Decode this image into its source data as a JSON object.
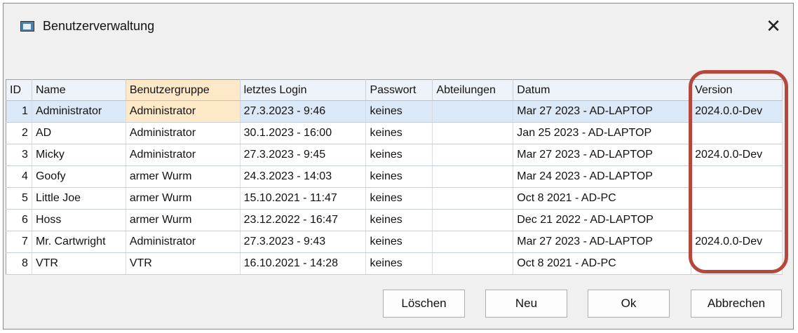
{
  "window": {
    "title": "Benutzerverwaltung",
    "icon": "window-app-icon",
    "close_label": "✕"
  },
  "table": {
    "columns": [
      "ID",
      "Name",
      "Benutzergruppe",
      "letztes Login",
      "Passwort",
      "Abteilungen",
      "Datum",
      "Version"
    ],
    "rows": [
      [
        "1",
        "Administrator",
        "Administrator",
        "27.3.2023 - 9:46",
        "keines",
        "",
        "Mar 27 2023 - AD-LAPTOP",
        "2024.0.0-Dev"
      ],
      [
        "2",
        "AD",
        "Administrator",
        "30.1.2023 - 16:00",
        "keines",
        "",
        "Jan 25 2023 - AD-LAPTOP",
        ""
      ],
      [
        "3",
        "Micky",
        "Administrator",
        "27.3.2023 - 9:45",
        "keines",
        "",
        "Mar 27 2023 - AD-LAPTOP",
        "2024.0.0-Dev"
      ],
      [
        "4",
        "Goofy",
        "armer Wurm",
        "24.3.2023 - 14:03",
        "keines",
        "",
        "Mar 24 2023 - AD-LAPTOP",
        ""
      ],
      [
        "5",
        "Little Joe",
        "armer Wurm",
        "15.10.2021 - 11:47",
        "keines",
        "",
        "Oct  8 2021 - AD-PC",
        ""
      ],
      [
        "6",
        "Hoss",
        "armer Wurm",
        "23.12.2022 - 16:47",
        "keines",
        "",
        "Dec 21 2022 - AD-LAPTOP",
        ""
      ],
      [
        "7",
        "Mr. Cartwright",
        "Administrator",
        "27.3.2023 - 9:43",
        "keines",
        "",
        "Mar 27 2023 - AD-LAPTOP",
        "2024.0.0-Dev"
      ],
      [
        "8",
        "VTR",
        "VTR",
        "16.10.2021 - 14:28",
        "keines",
        "",
        "Oct  8 2021 - AD-PC",
        ""
      ]
    ],
    "selected_row": 0,
    "sorted_column": 2
  },
  "buttons": {
    "delete": "Löschen",
    "new": "Neu",
    "ok": "Ok",
    "cancel": "Abbrechen"
  },
  "colors": {
    "selection": "#dbe8f7",
    "sort_highlight": "#fde8c8",
    "annotation": "#b5483c"
  }
}
